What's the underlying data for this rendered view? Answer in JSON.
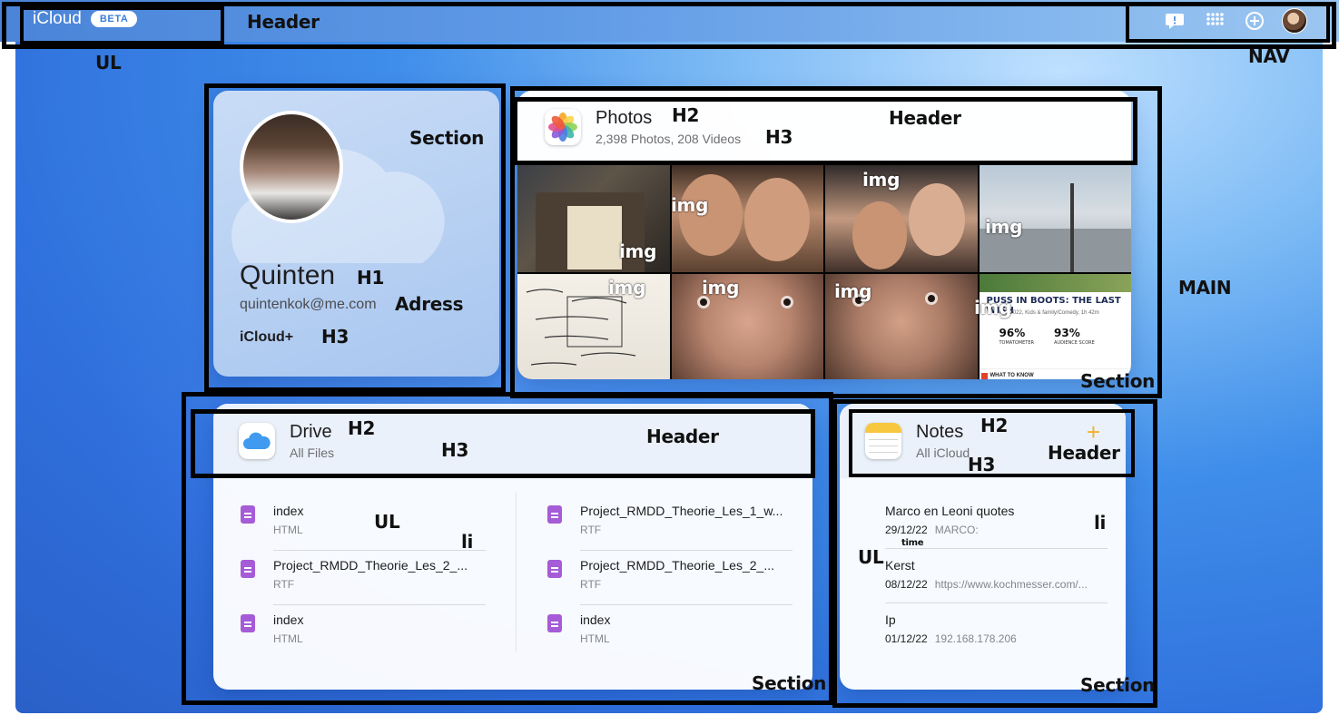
{
  "header": {
    "brand": "iCloud",
    "badge": "BETA"
  },
  "nav": {
    "icons": [
      "feedback-icon",
      "app-grid-icon",
      "add-icon",
      "avatar"
    ]
  },
  "profile": {
    "name": "Quinten",
    "email": "quintenkok@me.com",
    "plan": "iCloud+"
  },
  "photos": {
    "title": "Photos",
    "subtitle": "2,398 Photos, 208 Videos",
    "poster": {
      "title": "PUSS IN BOOTS: THE LAST WISH",
      "meta": "PG, 2022, Kids & family/Comedy, 1h 42m",
      "tomatometer": "96%",
      "tomatometer_label": "TOMATOMETER",
      "audience": "93%",
      "audience_label": "AUDIENCE SCORE",
      "what_to_know": "WHAT TO KNOW"
    }
  },
  "drive": {
    "title": "Drive",
    "subtitle": "All Files",
    "files_left": [
      {
        "name": "index",
        "type": "HTML"
      },
      {
        "name": "Project_RMDD_Theorie_Les_2_...",
        "type": "RTF"
      },
      {
        "name": "index",
        "type": "HTML"
      }
    ],
    "files_right": [
      {
        "name": "Project_RMDD_Theorie_Les_1_w...",
        "type": "RTF"
      },
      {
        "name": "Project_RMDD_Theorie_Les_2_...",
        "type": "RTF"
      },
      {
        "name": "index",
        "type": "HTML"
      }
    ]
  },
  "notes": {
    "title": "Notes",
    "subtitle": "All iCloud",
    "add": "+",
    "items": [
      {
        "title": "Marco en Leoni quotes",
        "date": "29/12/22",
        "preview": "MARCO:"
      },
      {
        "title": "Kerst",
        "date": "08/12/22",
        "preview": "https://www.kochmesser.com/..."
      },
      {
        "title": "Ip",
        "date": "01/12/22",
        "preview": "192.168.178.206"
      }
    ]
  },
  "annotations": {
    "header": "Header",
    "ul": "UL",
    "nav": "NAV",
    "main": "MAIN",
    "section": "Section",
    "h1": "H1",
    "h2": "H2",
    "h3": "H3",
    "address": "Adress",
    "img": "img",
    "li": "li",
    "time": "time"
  },
  "colors": {
    "accent": "#3b7ed8",
    "file_icon": "#a55cd6",
    "notes_add": "#f2b12e",
    "annotation": "#000000"
  }
}
